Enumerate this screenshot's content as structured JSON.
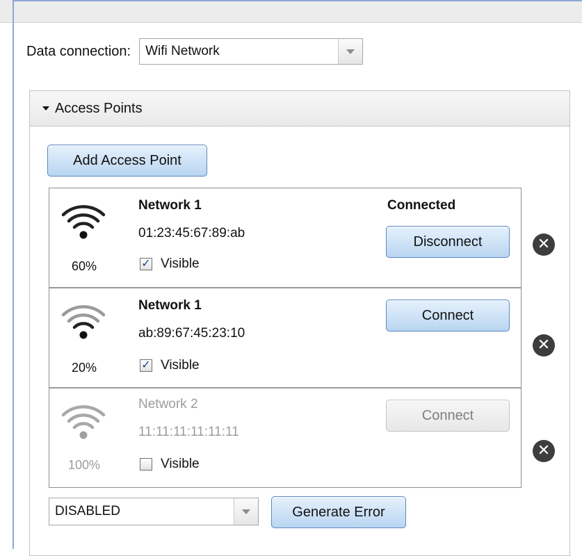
{
  "data_connection": {
    "label": "Data connection:",
    "selected": "Wifi Network"
  },
  "access_points": {
    "title": "Access Points",
    "add_button": "Add Access Point",
    "items": [
      {
        "name": "Network 1",
        "mac": "01:23:45:67:89:ab",
        "signal": "60%",
        "visible_label": "Visible",
        "visible": true,
        "status": "Connected",
        "action": "Disconnect",
        "enabled": true
      },
      {
        "name": "Network 1",
        "mac": "ab:89:67:45:23:10",
        "signal": "20%",
        "visible_label": "Visible",
        "visible": true,
        "status": "",
        "action": "Connect",
        "enabled": true
      },
      {
        "name": "Network 2",
        "mac": "11:11:11:11:11:11",
        "signal": "100%",
        "visible_label": "Visible",
        "visible": false,
        "status": "",
        "action": "Connect",
        "enabled": false
      }
    ],
    "error_select": "DISABLED",
    "generate_error": "Generate Error"
  },
  "icons": {
    "wifi": "wifi-signal-icon",
    "remove": "remove-circle-icon",
    "dropdown": "chevron-down-icon",
    "collapse": "collapse-triangle-icon",
    "check": "checkmark-icon"
  },
  "colors": {
    "button_top": "#e6f1fc",
    "button_bottom": "#b9d5f1",
    "button_border": "#5a87bf",
    "disabled_text": "#9c9c9c",
    "frame_accent": "#8ea6d6"
  }
}
